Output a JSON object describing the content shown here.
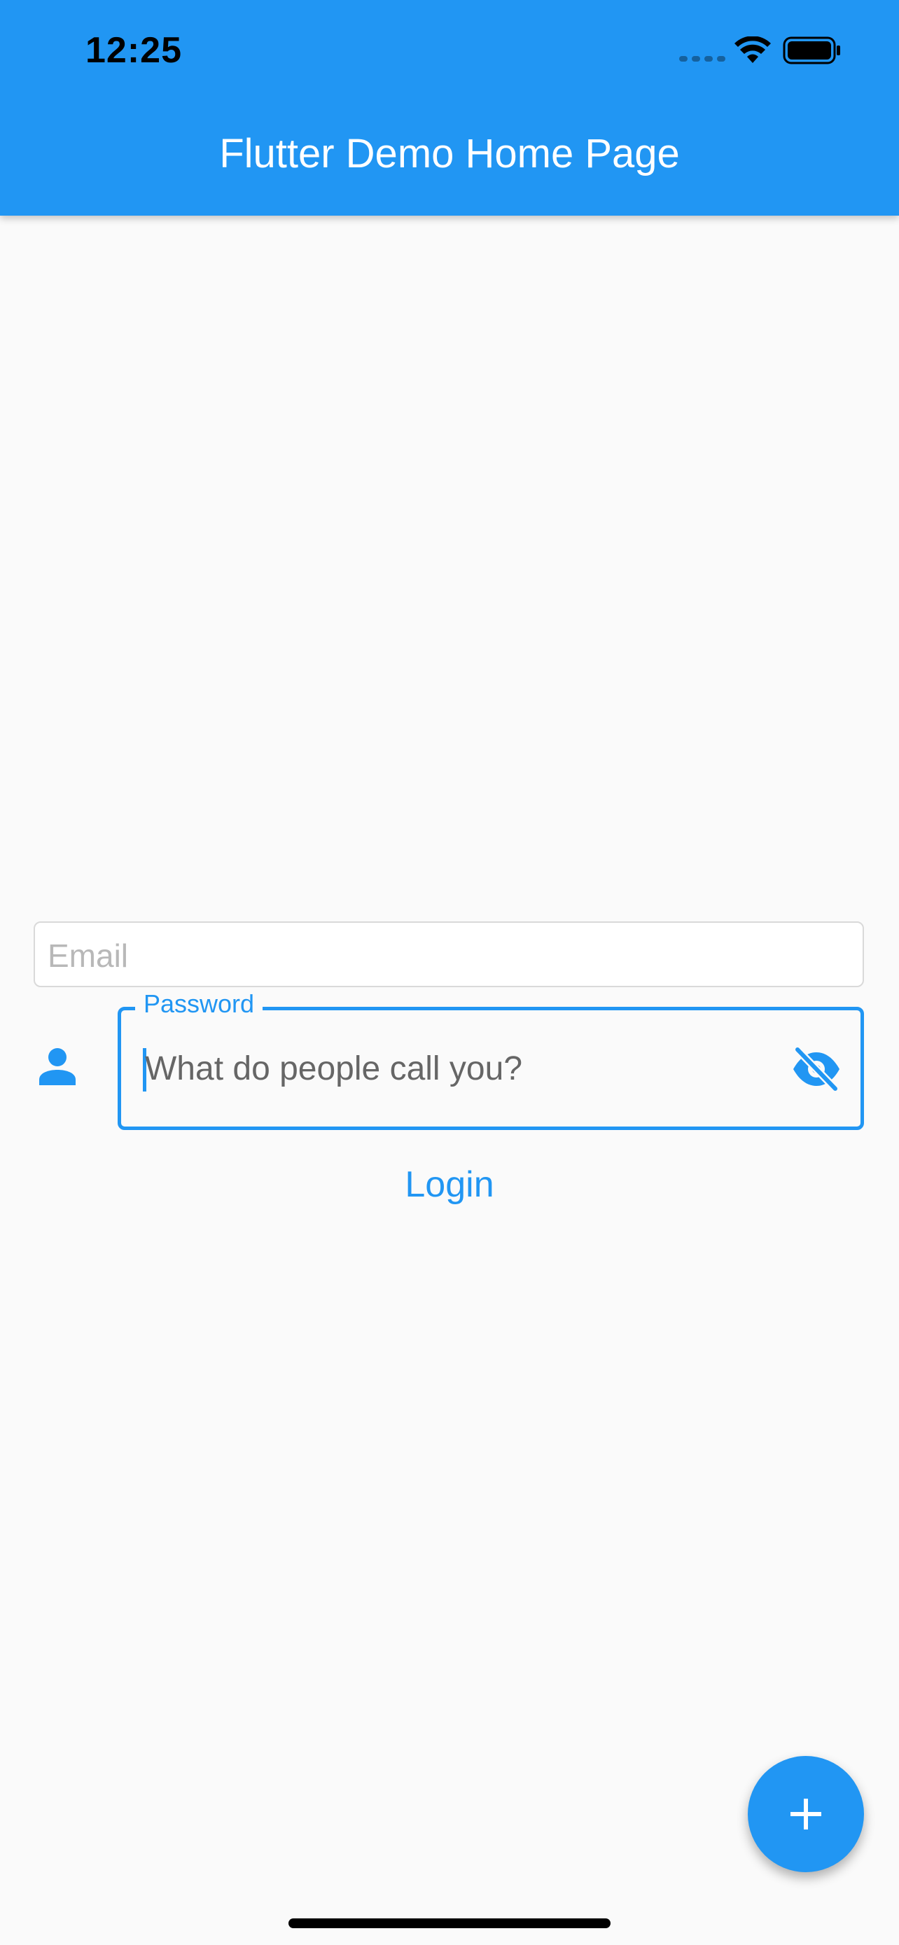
{
  "status_bar": {
    "time": "12:25",
    "icons": [
      "cellular-signal-icon",
      "wifi-icon",
      "battery-icon"
    ]
  },
  "app_bar": {
    "title": "Flutter Demo Home Page"
  },
  "form": {
    "email": {
      "placeholder": "Email",
      "value": ""
    },
    "password": {
      "label": "Password",
      "hint": "What do people call you?",
      "value": "",
      "prefix_icon": "person-icon",
      "suffix_icon": "visibility-off-icon"
    },
    "login_label": "Login"
  },
  "fab": {
    "icon": "add-icon"
  },
  "colors": {
    "primary": "#2196f3",
    "background": "#fafafa",
    "placeholder": "#b8b8b8",
    "hint": "#666666"
  }
}
